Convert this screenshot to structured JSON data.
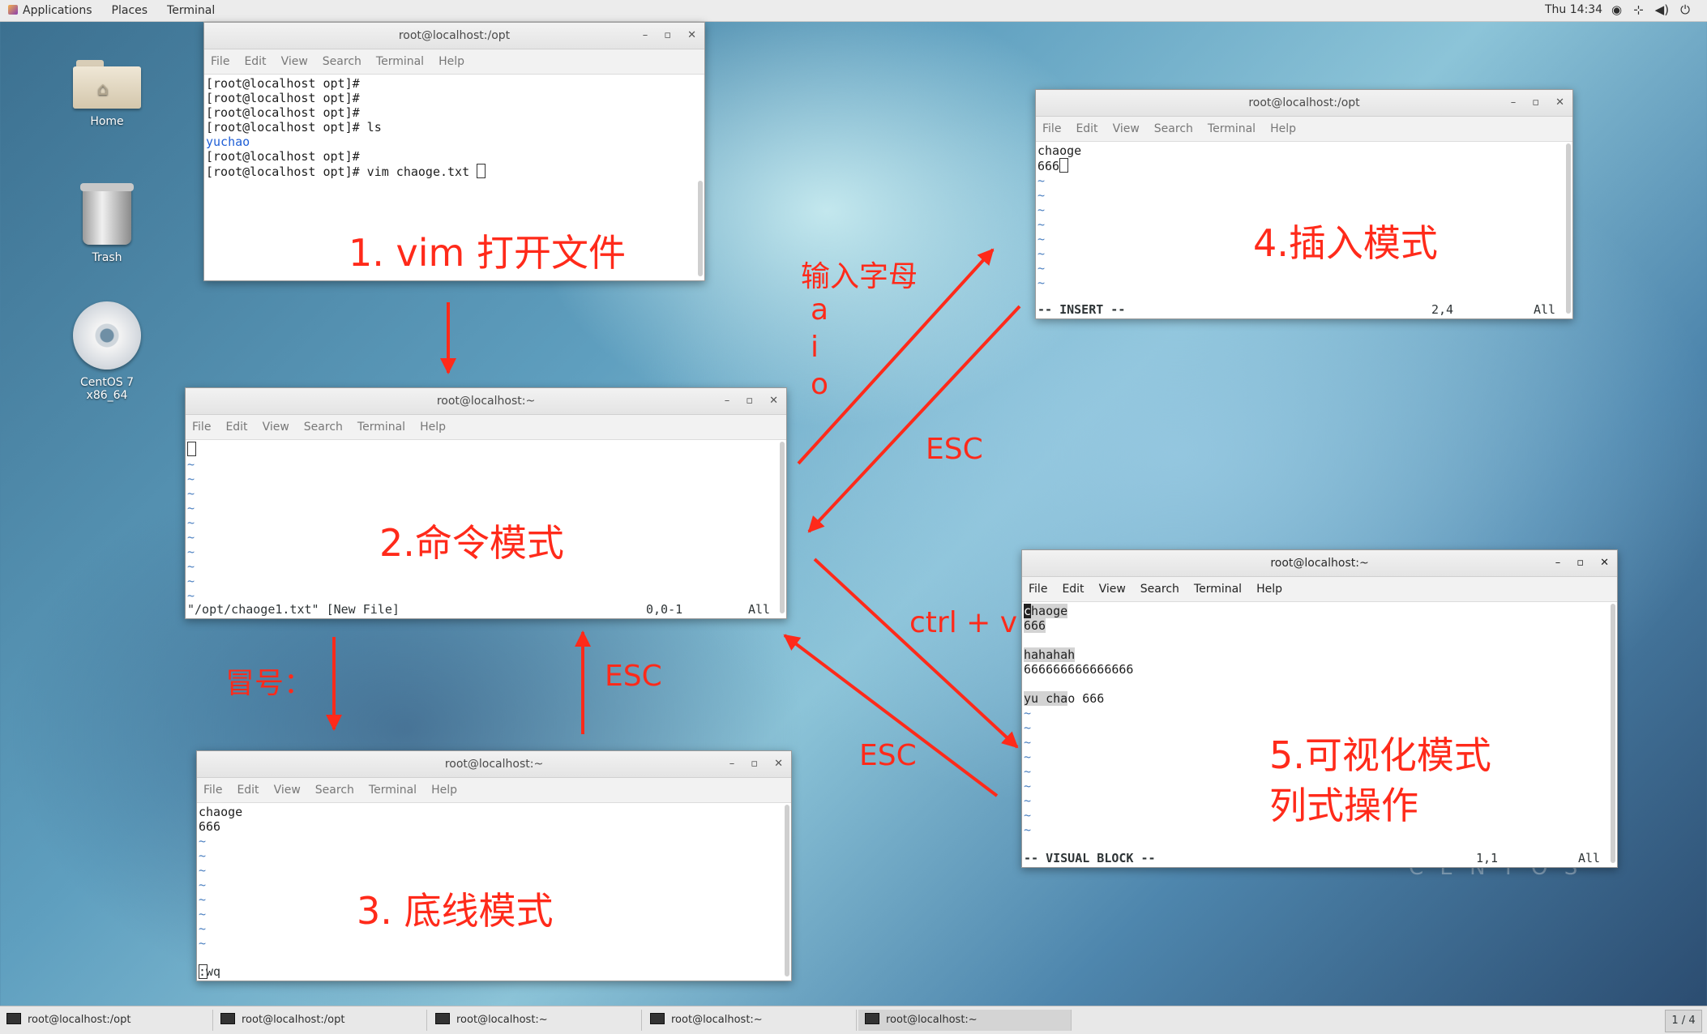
{
  "topbar": {
    "menus": [
      "Applications",
      "Places",
      "Terminal"
    ],
    "clock": "Thu 14:34",
    "tray_icons": [
      "accessibility-icon",
      "network-icon",
      "volume-icon",
      "power-icon"
    ]
  },
  "desktop": {
    "icons": [
      {
        "label": "Home",
        "icon": "home-folder-icon"
      },
      {
        "label": "Trash",
        "icon": "trash-icon"
      },
      {
        "label": "CentOS 7 x86_64",
        "icon": "disc-icon"
      }
    ],
    "watermark": "C E N T O S"
  },
  "menu_items": [
    "File",
    "Edit",
    "View",
    "Search",
    "Terminal",
    "Help"
  ],
  "windows": {
    "w1": {
      "title": "root@localhost:/opt",
      "lines": [
        "[root@localhost opt]#",
        "[root@localhost opt]#",
        "[root@localhost opt]#",
        "[root@localhost opt]# ls"
      ],
      "ls_output": "yuchao",
      "lines2": [
        "[root@localhost opt]#",
        "[root@localhost opt]# vim chaoge.txt "
      ]
    },
    "w2": {
      "title": "root@localhost:~",
      "status_left": "\"/opt/chaoge1.txt\" [New File]",
      "status_pos": "0,0-1",
      "status_all": "All"
    },
    "w3": {
      "title": "root@localhost:~",
      "lines": [
        "chaoge",
        "666"
      ],
      "command": ":wq"
    },
    "w4": {
      "title": "root@localhost:/opt",
      "lines": [
        "chaoge",
        "666"
      ],
      "status_mode": "-- INSERT --",
      "status_pos": "2,4",
      "status_all": "All"
    },
    "w5": {
      "title": "root@localhost:~",
      "line1_first": "c",
      "line1_rest": "haoge",
      "line2": "666",
      "line4": "hahahah",
      "line5": "666666666666666",
      "line7_sel": "yu cha",
      "line7_rest": "o 666",
      "status_mode": "-- VISUAL BLOCK --",
      "status_pos": "1,1",
      "status_all": "All"
    }
  },
  "annotations": {
    "step1": "1. vim 打开文件",
    "step2": "2.命令模式",
    "step3": "3. 底线模式",
    "step4": "4.插入模式",
    "step5a": "5.可视化模式",
    "step5b": "列式操作",
    "input_letters": "输入字母",
    "letter_a": "a",
    "letter_i": "i",
    "letter_o": "o",
    "esc_insert": "ESC",
    "esc_lastline": "ESC",
    "esc_visual": "ESC",
    "ctrl_v": "ctrl + v",
    "colon": "冒号："
  },
  "taskbar": {
    "tasks": [
      "root@localhost:/opt",
      "root@localhost:/opt",
      "root@localhost:~",
      "root@localhost:~",
      "root@localhost:~"
    ],
    "pager": "1 / 4"
  },
  "colors": {
    "annotation_red": "#ff2a1a",
    "tilde_blue": "#4a7fc0",
    "ls_blue": "#1f5fd6"
  }
}
